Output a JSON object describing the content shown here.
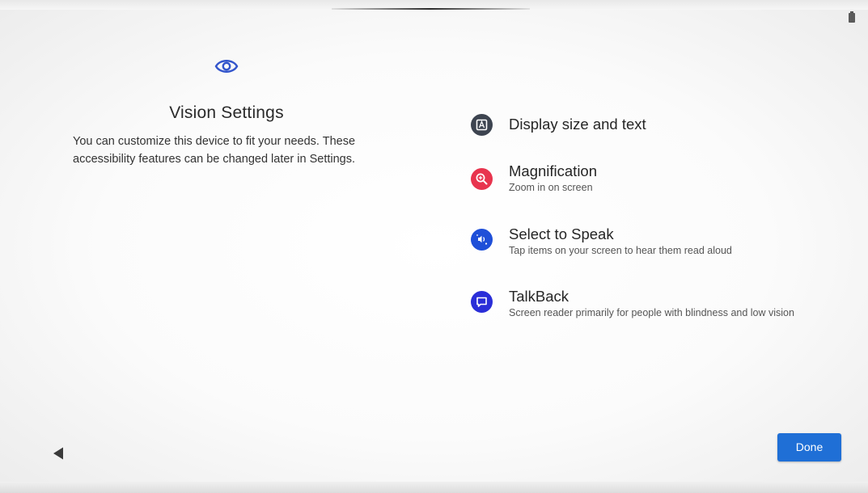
{
  "status_bar": {
    "battery_icon": "battery-icon"
  },
  "header": {
    "icon": "eye-icon",
    "icon_color": "#3355cc",
    "title": "Vision Settings",
    "description": "You can customize this device to fit your needs. These accessibility features can be changed later in Settings."
  },
  "features": [
    {
      "icon": "display-size-icon",
      "icon_color": "#3d4450",
      "title": "Display size and text",
      "subtitle": ""
    },
    {
      "icon": "magnification-icon",
      "icon_color": "#e8344e",
      "title": "Magnification",
      "subtitle": "Zoom in on screen"
    },
    {
      "icon": "select-to-speak-icon",
      "icon_color": "#1f4fd8",
      "title": "Select to Speak",
      "subtitle": "Tap items on your screen to hear them read aloud"
    },
    {
      "icon": "talkback-icon",
      "icon_color": "#2a2ed8",
      "title": "TalkBack",
      "subtitle": "Screen reader primarily for people with blindness and low vision"
    }
  ],
  "navigation": {
    "back_icon": "back-triangle-icon",
    "done_label": "Done",
    "done_color": "#1f6fd6"
  }
}
